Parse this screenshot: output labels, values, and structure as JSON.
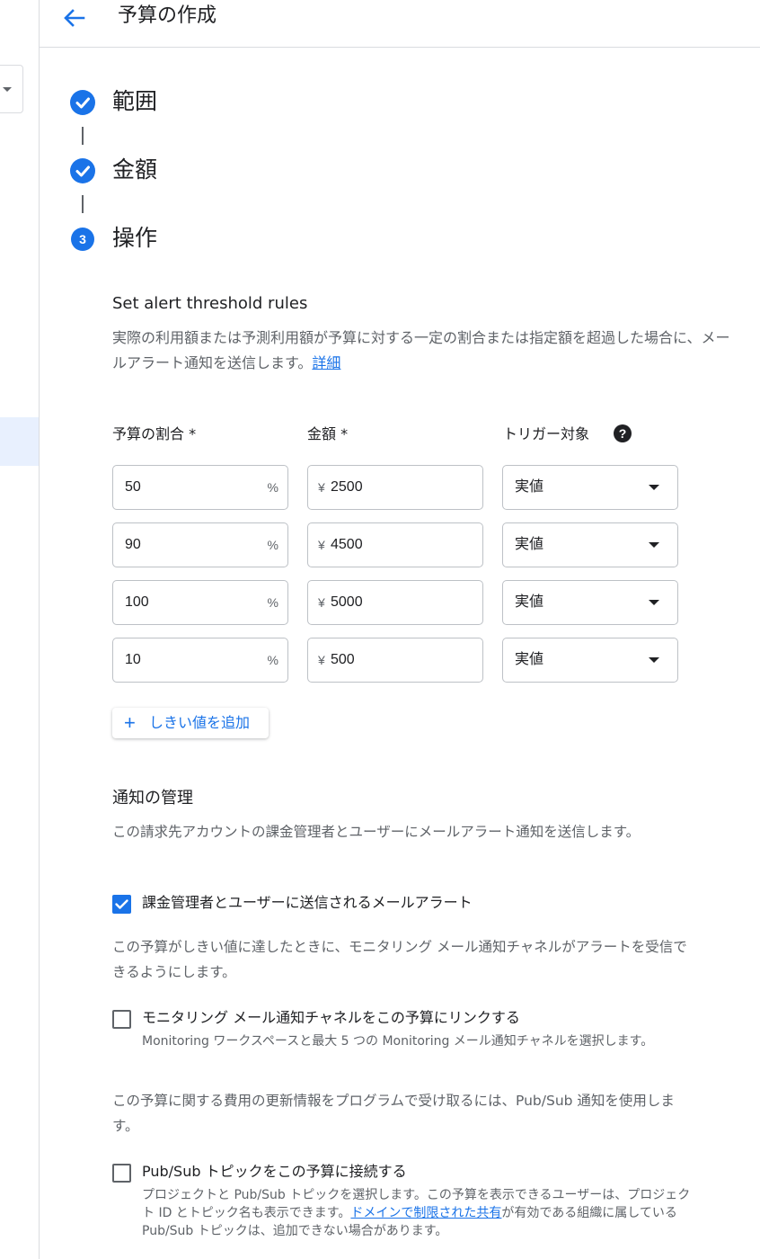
{
  "header": {
    "back_icon": "arrow-back-icon",
    "title": "予算の作成"
  },
  "steps": [
    {
      "label": "範囲",
      "state": "done",
      "icon": "check-circle-icon"
    },
    {
      "label": "金額",
      "state": "done",
      "icon": "check-circle-icon"
    },
    {
      "label": "操作",
      "state": "current",
      "number": "3"
    }
  ],
  "alerts": {
    "title": "Set alert threshold rules",
    "description": "実際の利用額または予測利用額が予算に対する一定の割合または指定額を超過した場合に、メールアラート通知を送信します。",
    "link": "詳細",
    "columns": {
      "percent": "予算の割合 *",
      "amount": "金額 *",
      "trigger": "トリガー対象"
    },
    "help_icon": "?",
    "percent_suffix": "%",
    "currency": "¥",
    "rows": [
      {
        "percent": "50",
        "amount": "2500",
        "trigger": "実値"
      },
      {
        "percent": "90",
        "amount": "4500",
        "trigger": "実値"
      },
      {
        "percent": "100",
        "amount": "5000",
        "trigger": "実値"
      },
      {
        "percent": "10",
        "amount": "500",
        "trigger": "実値"
      }
    ],
    "add_button": "しきい値を追加"
  },
  "notifications": {
    "title": "通知の管理",
    "description": "この請求先アカウントの課金管理者とユーザーにメールアラート通知を送信します。",
    "email_checkbox": {
      "label": "課金管理者とユーザーに送信されるメールアラート",
      "checked": true
    },
    "monitoring_desc": "この予算がしきい値に達したときに、モニタリング メール通知チャネルがアラートを受信できるようにします。",
    "monitoring_checkbox": {
      "label": "モニタリング メール通知チャネルをこの予算にリンクする",
      "checked": false,
      "sub": "Monitoring ワークスペースと最大 5 つの Monitoring メール通知チャネルを選択します。"
    },
    "pubsub_desc": "この予算に関する費用の更新情報をプログラムで受け取るには、Pub/Sub 通知を使用します。",
    "pubsub_checkbox": {
      "label": "Pub/Sub トピックをこの予算に接続する",
      "checked": false,
      "sub_before": "プロジェクトと Pub/Sub トピックを選択します。この予算を表示できるユーザーは、プロジェクト ID とトピック名も表示できます。",
      "sub_link": "ドメインで制限された共有",
      "sub_after": "が有効である組織に属している Pub/Sub トピックは、追加できない場合があります。"
    }
  },
  "colors": {
    "accent": "#1a73e8",
    "text": "#202124",
    "secondary_text": "#5f6368",
    "border": "#dadce0"
  }
}
